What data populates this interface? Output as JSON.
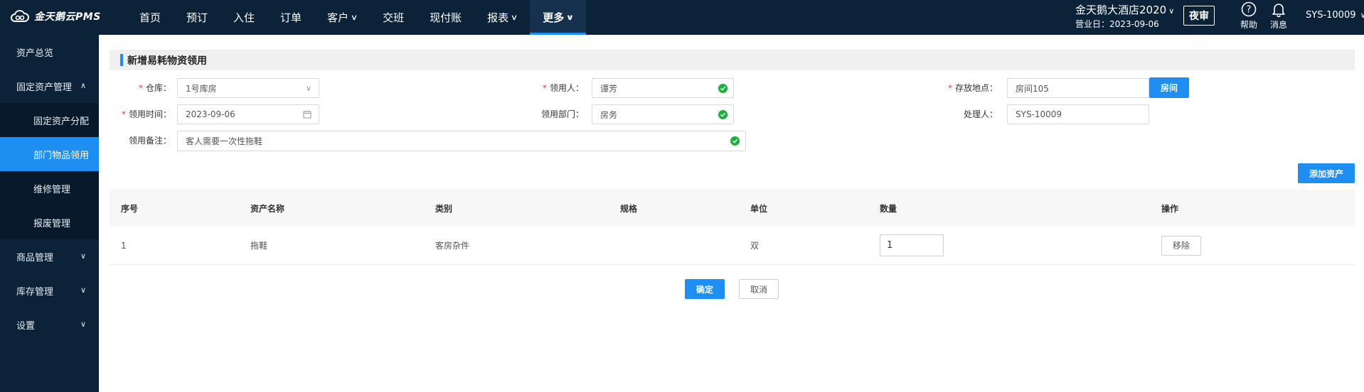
{
  "app": {
    "logo_text": "金天鹅云PMS"
  },
  "nav": {
    "items": [
      {
        "label": "首页",
        "dropdown": false
      },
      {
        "label": "预订",
        "dropdown": false
      },
      {
        "label": "入住",
        "dropdown": false
      },
      {
        "label": "订单",
        "dropdown": false
      },
      {
        "label": "客户",
        "dropdown": true
      },
      {
        "label": "交班",
        "dropdown": false
      },
      {
        "label": "现付账",
        "dropdown": false
      },
      {
        "label": "报表",
        "dropdown": true
      },
      {
        "label": "更多",
        "dropdown": true,
        "active": true
      }
    ]
  },
  "header": {
    "hotel_name": "金天鹅大酒店2020",
    "business_day": "营业日：2023-09-06",
    "night_audit": "夜审",
    "help": "帮助",
    "messages": "消息",
    "user": "SYS-10009"
  },
  "sidebar": {
    "items": [
      {
        "label": "资产总览"
      },
      {
        "label": "固定资产管理",
        "expanded": true
      },
      {
        "label": "固定资产分配"
      },
      {
        "label": "部门物品领用",
        "active": true
      },
      {
        "label": "维修管理"
      },
      {
        "label": "报废管理"
      },
      {
        "label": "商品管理"
      },
      {
        "label": "库存管理"
      },
      {
        "label": "设置"
      }
    ]
  },
  "form": {
    "title": "新增易耗物资领用",
    "warehouse": {
      "label": "仓库：",
      "value": "1号库房",
      "required": true
    },
    "recipient": {
      "label": "领用人：",
      "value": "谭芳",
      "required": true
    },
    "location": {
      "label": "存放地点：",
      "value": "房间105",
      "required": true,
      "button": "房间"
    },
    "date": {
      "label": "领用时间：",
      "value": "2023-09-06",
      "required": true
    },
    "department": {
      "label": "领用部门：",
      "value": "房务"
    },
    "handler": {
      "label": "处理人：",
      "value": "SYS-10009"
    },
    "remark": {
      "label": "领用备注：",
      "value": "客人需要一次性拖鞋"
    },
    "add_asset_button": "添加资产"
  },
  "table": {
    "columns": [
      "序号",
      "资产名称",
      "类别",
      "规格",
      "单位",
      "数量",
      "操作"
    ],
    "rows": [
      {
        "index": "1",
        "name": "拖鞋",
        "category": "客房杂件",
        "spec": "",
        "unit": "双",
        "quantity": "1",
        "action": "移除"
      }
    ]
  },
  "actions": {
    "confirm": "确定",
    "cancel": "取消"
  },
  "colors": {
    "topbar": "#0b2238",
    "accent": "#1e8ef2",
    "valid": "#1bb03c",
    "required": "#e4393c"
  }
}
